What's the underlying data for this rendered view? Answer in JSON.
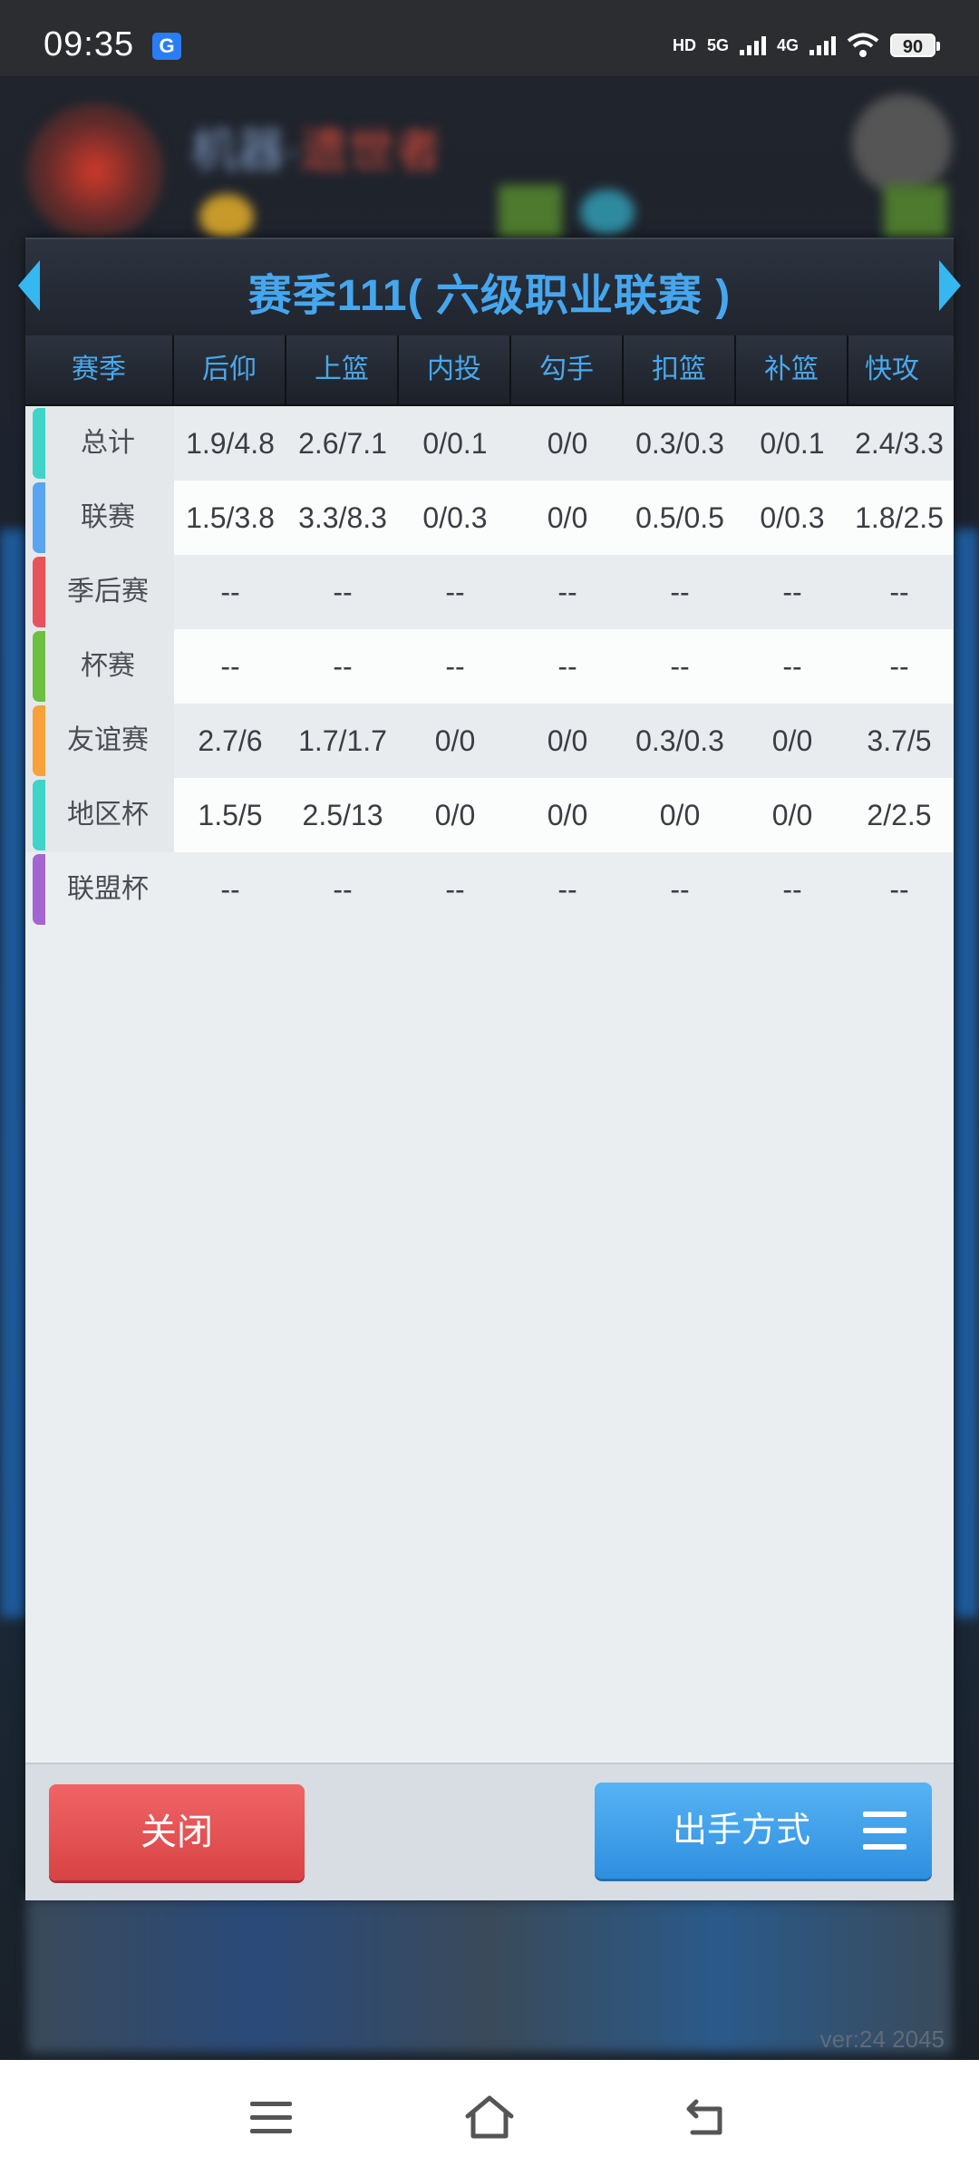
{
  "status_bar": {
    "time": "09:35",
    "app_icon": "G",
    "network_hd": "HD",
    "net_5g": "5G",
    "net_4g": "4G",
    "battery": "90"
  },
  "background": {
    "team_title_blue": "机器·",
    "team_title_red": "遗世者",
    "version": "ver:24  2045"
  },
  "dialog": {
    "title": "赛季111( 六级职业联赛 )",
    "headers": [
      "赛季",
      "后仰",
      "上篮",
      "内投",
      "勾手",
      "扣篮",
      "补篮",
      "快攻"
    ],
    "rows": [
      {
        "label": "总计",
        "color": "#3fd4c8",
        "values": [
          "1.9/4.8",
          "2.6/7.1",
          "0/0.1",
          "0/0",
          "0.3/0.3",
          "0/0.1",
          "2.4/3.3"
        ]
      },
      {
        "label": "联赛",
        "color": "#5aa4f0",
        "values": [
          "1.5/3.8",
          "3.3/8.3",
          "0/0.3",
          "0/0",
          "0.5/0.5",
          "0/0.3",
          "1.8/2.5"
        ]
      },
      {
        "label": "季后赛",
        "color": "#e8525a",
        "values": [
          "--",
          "--",
          "--",
          "--",
          "--",
          "--",
          "--"
        ]
      },
      {
        "label": "杯赛",
        "color": "#6cc040",
        "values": [
          "--",
          "--",
          "--",
          "--",
          "--",
          "--",
          "--"
        ]
      },
      {
        "label": "友谊赛",
        "color": "#f7a13a",
        "values": [
          "2.7/6",
          "1.7/1.7",
          "0/0",
          "0/0",
          "0.3/0.3",
          "0/0",
          "3.7/5"
        ]
      },
      {
        "label": "地区杯",
        "color": "#3fd4c8",
        "values": [
          "1.5/5",
          "2.5/13",
          "0/0",
          "0/0",
          "0/0",
          "0/0",
          "2/2.5"
        ]
      },
      {
        "label": "联盟杯",
        "color": "#a565d0",
        "values": [
          "--",
          "--",
          "--",
          "--",
          "--",
          "--",
          "--"
        ]
      }
    ],
    "close_label": "关闭",
    "method_label": "出手方式"
  },
  "icons": {
    "prev": "left-arrow-icon",
    "next": "right-arrow-icon",
    "menu": "menu-icon",
    "nav_menu": "nav-menu-icon",
    "nav_home": "nav-home-icon",
    "nav_back": "nav-back-icon"
  }
}
